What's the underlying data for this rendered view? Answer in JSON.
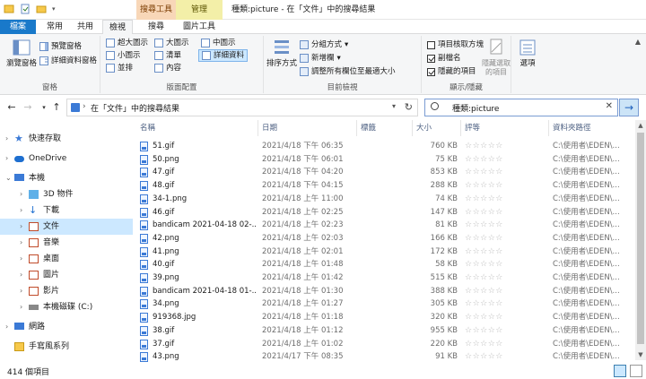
{
  "window": {
    "title": "種類:picture - 在「文件」中的搜尋結果",
    "context_tabs": [
      "搜尋工具",
      "管理"
    ]
  },
  "ribbon_tabs": [
    "檔案",
    "常用",
    "共用",
    "檢視",
    "搜尋",
    "圖片工具"
  ],
  "ribbon": {
    "panes": {
      "nav_pane": "瀏覽窗格",
      "preview": "預覽窗格",
      "details": "詳細資料窗格",
      "label": "窗格"
    },
    "layout": {
      "items": [
        "超大圖示",
        "大圖示",
        "中圖示",
        "小圖示",
        "清單",
        "詳細資料",
        "並排",
        "內容"
      ],
      "label": "版面配置"
    },
    "current_view": {
      "sort": "排序方式",
      "group_by": "分組方式",
      "add_column": "新增欄",
      "fit_columns": "調整所有欄位至最適大小",
      "label": "目前檢視"
    },
    "show_hide": {
      "item_checkboxes": "項目核取方塊",
      "extensions": "副檔名",
      "hidden_items": "隱藏的項目",
      "hide_selected": "隱藏選取的項目",
      "label": "顯示/隱藏"
    },
    "options": "選項"
  },
  "address": {
    "path": "在「文件」中的搜尋結果",
    "search": "種類:picture"
  },
  "nav": [
    {
      "label": "快速存取",
      "expanded": false
    },
    {
      "label": "OneDrive",
      "expanded": false
    },
    {
      "label": "本機",
      "expanded": true
    },
    {
      "label": "3D 物件",
      "expanded": false
    },
    {
      "label": "下載",
      "expanded": false
    },
    {
      "label": "文件",
      "expanded": false
    },
    {
      "label": "音樂",
      "expanded": false
    },
    {
      "label": "桌面",
      "expanded": false
    },
    {
      "label": "圖片",
      "expanded": false
    },
    {
      "label": "影片",
      "expanded": false
    },
    {
      "label": "本機磁碟 (C:)",
      "expanded": false
    },
    {
      "label": "網路",
      "expanded": false
    },
    {
      "label": "手寫風系列",
      "expanded": false
    }
  ],
  "columns": [
    "名稱",
    "日期",
    "標籤",
    "大小",
    "評等",
    "資料夾路徑"
  ],
  "files": [
    {
      "name": "51.gif",
      "date": "2021/4/18 下午 06:35",
      "size": "760 KB",
      "path": "C:\\使用者\\EDEN\\..."
    },
    {
      "name": "50.png",
      "date": "2021/4/18 下午 06:01",
      "size": "75 KB",
      "path": "C:\\使用者\\EDEN\\..."
    },
    {
      "name": "47.gif",
      "date": "2021/4/18 下午 04:20",
      "size": "853 KB",
      "path": "C:\\使用者\\EDEN\\..."
    },
    {
      "name": "48.gif",
      "date": "2021/4/18 下午 04:15",
      "size": "288 KB",
      "path": "C:\\使用者\\EDEN\\..."
    },
    {
      "name": "34-1.png",
      "date": "2021/4/18 上午 11:00",
      "size": "74 KB",
      "path": "C:\\使用者\\EDEN\\..."
    },
    {
      "name": "46.gif",
      "date": "2021/4/18 上午 02:25",
      "size": "147 KB",
      "path": "C:\\使用者\\EDEN\\..."
    },
    {
      "name": "bandicam 2021-04-18 02-...",
      "date": "2021/4/18 上午 02:23",
      "size": "81 KB",
      "path": "C:\\使用者\\EDEN\\..."
    },
    {
      "name": "42.png",
      "date": "2021/4/18 上午 02:03",
      "size": "166 KB",
      "path": "C:\\使用者\\EDEN\\..."
    },
    {
      "name": "41.png",
      "date": "2021/4/18 上午 02:01",
      "size": "172 KB",
      "path": "C:\\使用者\\EDEN\\..."
    },
    {
      "name": "40.gif",
      "date": "2021/4/18 上午 01:48",
      "size": "58 KB",
      "path": "C:\\使用者\\EDEN\\..."
    },
    {
      "name": "39.png",
      "date": "2021/4/18 上午 01:42",
      "size": "515 KB",
      "path": "C:\\使用者\\EDEN\\..."
    },
    {
      "name": "bandicam 2021-04-18 01-...",
      "date": "2021/4/18 上午 01:30",
      "size": "388 KB",
      "path": "C:\\使用者\\EDEN\\..."
    },
    {
      "name": "34.png",
      "date": "2021/4/18 上午 01:27",
      "size": "305 KB",
      "path": "C:\\使用者\\EDEN\\..."
    },
    {
      "name": "919368.jpg",
      "date": "2021/4/18 上午 01:18",
      "size": "320 KB",
      "path": "C:\\使用者\\EDEN\\..."
    },
    {
      "name": "38.gif",
      "date": "2021/4/18 上午 01:12",
      "size": "955 KB",
      "path": "C:\\使用者\\EDEN\\..."
    },
    {
      "name": "37.gif",
      "date": "2021/4/18 上午 01:02",
      "size": "220 KB",
      "path": "C:\\使用者\\EDEN\\..."
    },
    {
      "name": "43.png",
      "date": "2021/4/17 下午 08:35",
      "size": "91 KB",
      "path": "C:\\使用者\\EDEN\\..."
    }
  ],
  "rating_stars": "☆☆☆☆☆",
  "status": {
    "count": "414 個項目"
  },
  "colors": {
    "accent": "#1979ca",
    "selection": "#cce8ff",
    "header_text": "#4d6082"
  }
}
